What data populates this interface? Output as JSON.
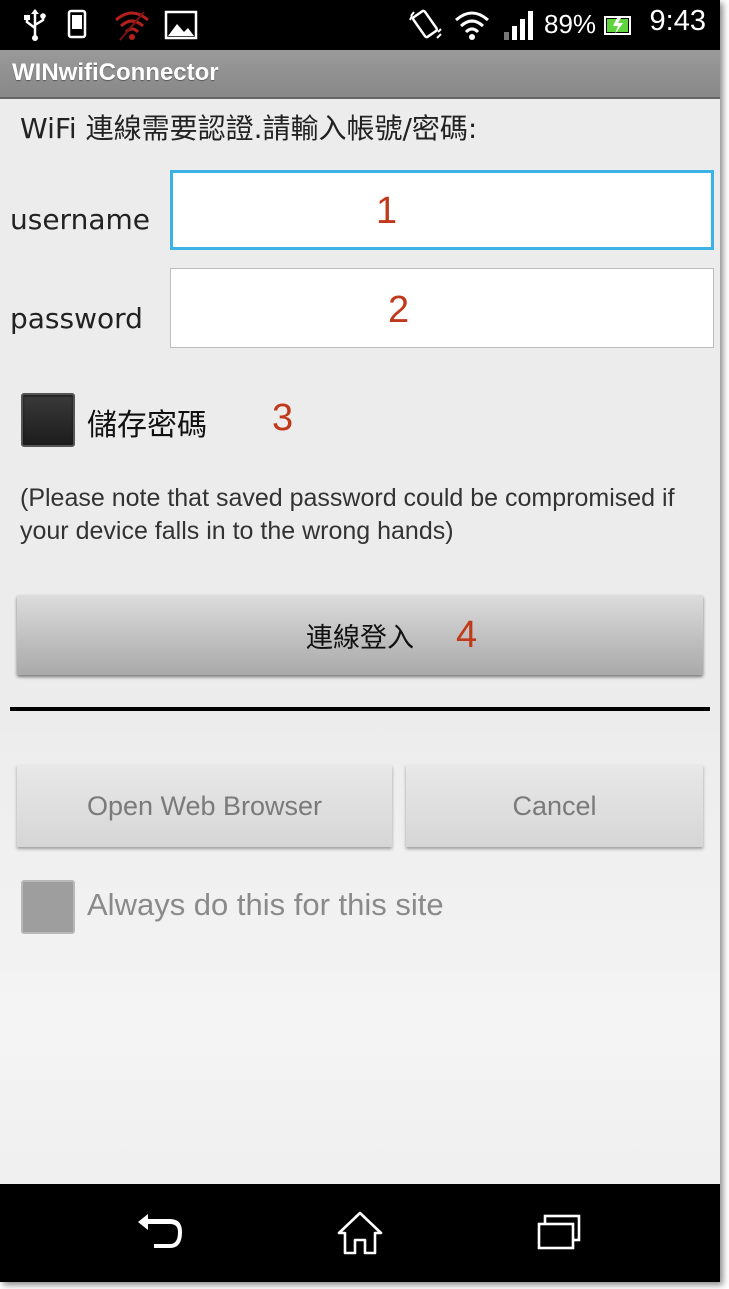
{
  "status_bar": {
    "battery_percent": "89%",
    "time": "9:43",
    "icons": [
      "usb-icon",
      "phone-storage-icon",
      "wifi-warning-icon",
      "image-icon",
      "vibrate-icon",
      "wifi-icon",
      "signal-icon",
      "battery-charging-icon"
    ]
  },
  "app": {
    "title": "WINwifiConnector"
  },
  "form": {
    "prompt": "WiFi 連線需要認證.請輸入帳號/密碼:",
    "username_label": "username",
    "password_label": "password",
    "username_value": "",
    "password_value": "",
    "save_password_label": "儲存密碼",
    "save_password_checked": false,
    "note": "(Please note that saved password could be compromised if your device falls in to the wrong hands)",
    "login_button": "連線登入"
  },
  "annotations": [
    "1",
    "2",
    "3",
    "4"
  ],
  "dialog": {
    "open_browser_button": "Open Web Browser",
    "cancel_button": "Cancel",
    "always_label": "Always do this for this site",
    "always_checked": false
  },
  "nav_bar": {
    "icons": [
      "back-icon",
      "home-icon",
      "recent-apps-icon"
    ]
  },
  "colors": {
    "annotation": "#c0391b",
    "focus_border": "#3bb1e6"
  }
}
